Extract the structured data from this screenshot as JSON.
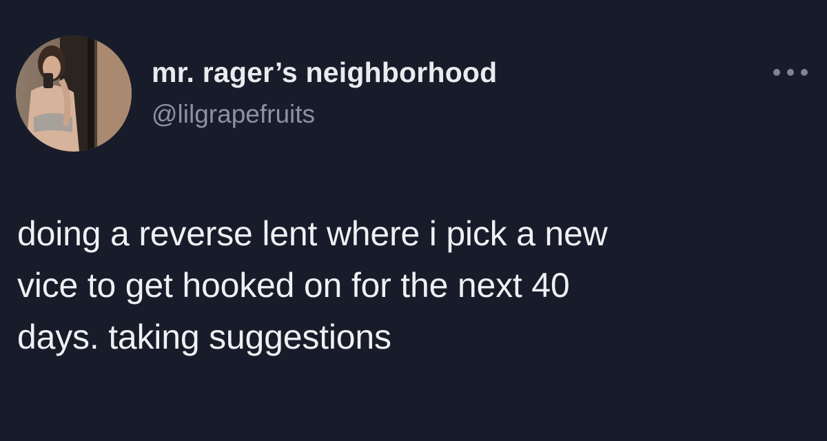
{
  "tweet": {
    "author": {
      "display_name": "mr. rager’s neighborhood",
      "handle": "@lilgrapefruits",
      "avatar_icon": "profile-photo"
    },
    "more_icon": "ellipsis-icon",
    "text": "doing a reverse lent where i pick a new\nvice to get hooked on for the next 40\ndays. taking suggestions"
  },
  "colors": {
    "background": "#181c2a",
    "text": "#eef0f3",
    "handle": "#8a93a3"
  }
}
